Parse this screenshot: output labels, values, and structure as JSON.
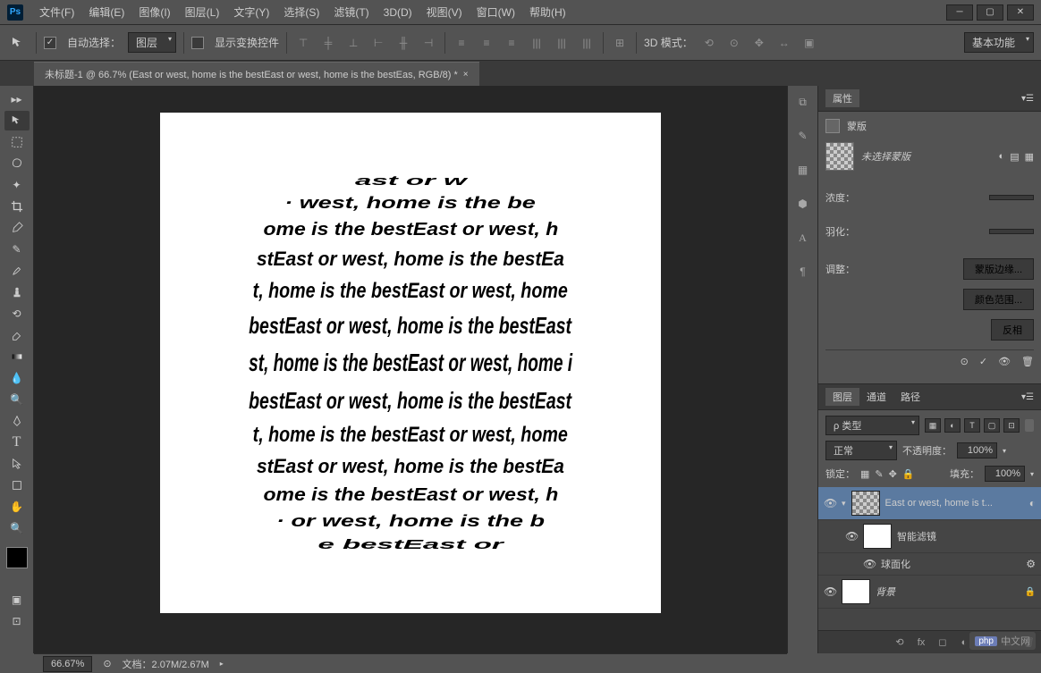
{
  "app": {
    "logo": "Ps"
  },
  "menu": {
    "items": [
      "文件(F)",
      "编辑(E)",
      "图像(I)",
      "图层(L)",
      "文字(Y)",
      "选择(S)",
      "滤镜(T)",
      "3D(D)",
      "视图(V)",
      "窗口(W)",
      "帮助(H)"
    ]
  },
  "options": {
    "auto_select": "自动选择：",
    "target_dropdown": "图层",
    "show_transform": "显示变换控件",
    "mode_3d_label": "3D 模式：",
    "workspace": "基本功能"
  },
  "document": {
    "tab_title": "未标题-1 @ 66.7% (East or west, home is the bestEast or west, home is the bestEas, RGB/8) *"
  },
  "canvas_text": {
    "base": "East or west, home is the bestEast or west, home is the best",
    "lines": [
      {
        "text": "ast or w",
        "size": 15,
        "scaleX": 2.2
      },
      {
        "text": "· west, home is the be",
        "size": 18,
        "scaleX": 1.5
      },
      {
        "text": "ome is the bestEast or west, h",
        "size": 20,
        "scaleX": 1.15
      },
      {
        "text": "stEast or west, home is the bestEa",
        "size": 22,
        "scaleX": 0.95
      },
      {
        "text": "t, home is the bestEast or west, home",
        "size": 24,
        "scaleX": 0.82
      },
      {
        "text": "bestEast or west, home is the bestEast",
        "size": 26,
        "scaleX": 0.75
      },
      {
        "text": "st, home is the bestEast or west, home i",
        "size": 28,
        "scaleX": 0.68
      },
      {
        "text": "bestEast or west, home is the bestEast",
        "size": 26,
        "scaleX": 0.75
      },
      {
        "text": "t, home is the bestEast or west, home",
        "size": 24,
        "scaleX": 0.82
      },
      {
        "text": "stEast or west, home is the bestEa",
        "size": 22,
        "scaleX": 0.95
      },
      {
        "text": "ome is the bestEast or west, h",
        "size": 20,
        "scaleX": 1.15
      },
      {
        "text": "· or west, home is the b",
        "size": 18,
        "scaleX": 1.5
      },
      {
        "text": "e bestEast or",
        "size": 15,
        "scaleX": 2.2
      }
    ]
  },
  "properties_panel": {
    "title": "属性",
    "mask_title": "蒙版",
    "no_mask": "未选择蒙版",
    "density_label": "浓度：",
    "feather_label": "羽化：",
    "adjust_label": "调整：",
    "mask_edge_btn": "蒙版边缘...",
    "color_range_btn": "颜色范围...",
    "invert_btn": "反相"
  },
  "layers_panel": {
    "tabs": [
      "图层",
      "通道",
      "路径"
    ],
    "kind_label": "ρ 类型",
    "blend_mode": "正常",
    "opacity_label": "不透明度：",
    "opacity_value": "100%",
    "lock_label": "锁定：",
    "fill_label": "填充：",
    "fill_value": "100%",
    "layers": [
      {
        "name": "East or west, home is t...",
        "type": "text",
        "visible": true,
        "selected": true,
        "smart": true
      },
      {
        "name": "智能滤镜",
        "type": "smart-filter",
        "visible": true,
        "indent": 1
      },
      {
        "name": "球面化",
        "type": "filter",
        "visible": true,
        "indent": 2
      },
      {
        "name": "背景",
        "type": "background",
        "visible": true,
        "locked": true
      }
    ]
  },
  "statusbar": {
    "zoom": "66.67%",
    "doc_info": "文档：2.07M/2.67M"
  },
  "watermark": {
    "text": "中文网",
    "logo": "php"
  }
}
